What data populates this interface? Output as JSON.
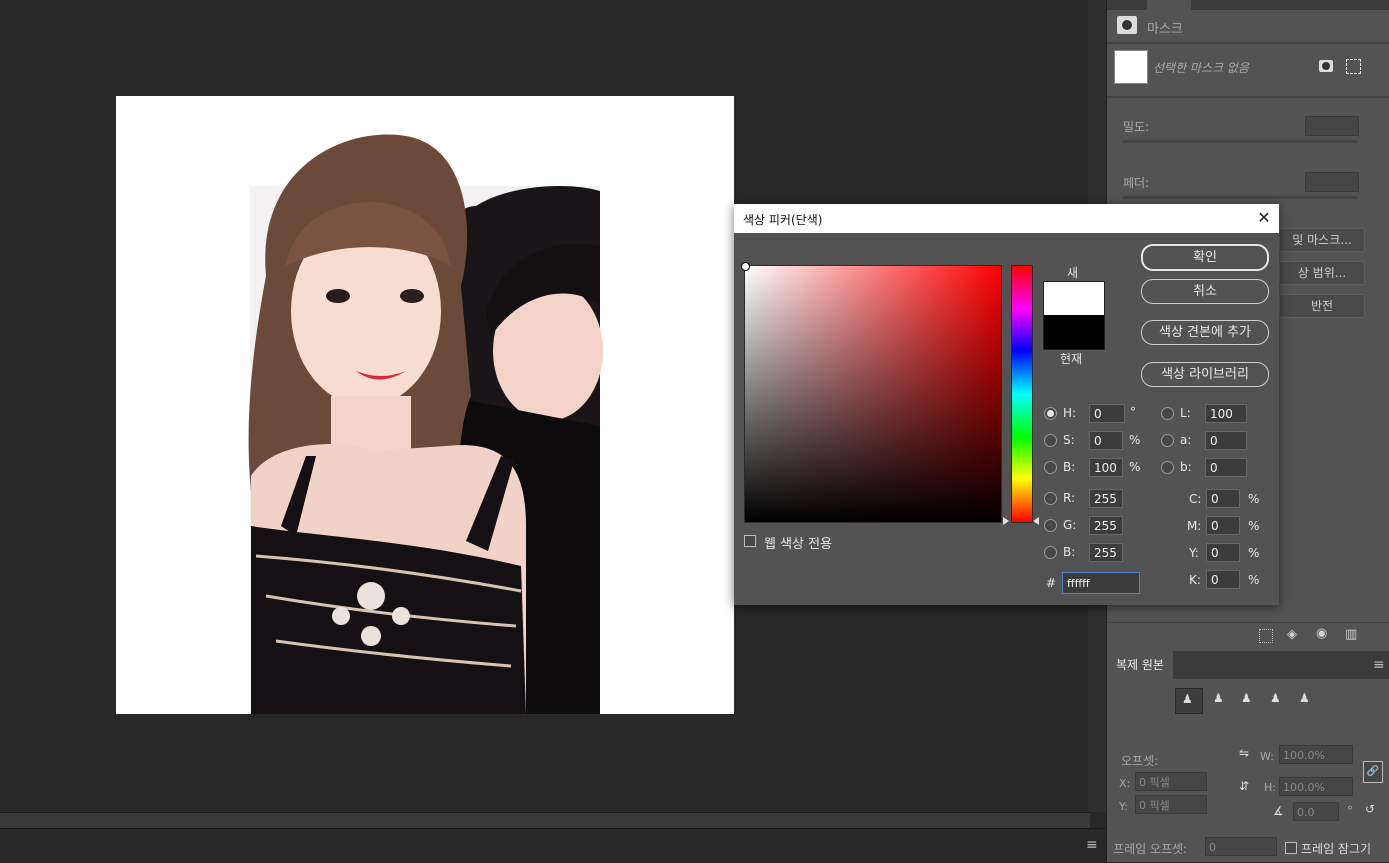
{
  "dialog": {
    "title": "색상 피커(단색)",
    "close_glyph": "✕",
    "new_label": "새",
    "current_label": "현재",
    "buttons": {
      "ok": "확인",
      "cancel": "취소",
      "add_to_swatches": "색상 견본에 추가",
      "color_libraries": "색상 라이브러리"
    },
    "web_only_label": "웹 색상 전용",
    "hsb": {
      "h_label": "H:",
      "h_value": "0",
      "h_unit": "°",
      "s_label": "S:",
      "s_value": "0",
      "s_unit": "%",
      "b_label": "B:",
      "b_value": "100",
      "b_unit": "%"
    },
    "lab": {
      "l_label": "L:",
      "l_value": "100",
      "a_label": "a:",
      "a_value": "0",
      "b_label": "b:",
      "b_value": "0"
    },
    "rgb": {
      "r_label": "R:",
      "r_value": "255",
      "g_label": "G:",
      "g_value": "255",
      "b_label": "B:",
      "b_value": "255"
    },
    "cmyk": {
      "c_label": "C:",
      "c_value": "0",
      "m_label": "M:",
      "m_value": "0",
      "y_label": "Y:",
      "y_value": "0",
      "k_label": "K:",
      "k_value": "0",
      "unit": "%"
    },
    "hex_label": "#",
    "hex_value": "ffffff",
    "selected_hue_color": "#ff0000",
    "new_color": "#ffffff",
    "current_color": "#000000"
  },
  "properties_panel": {
    "mask_title": "마스크",
    "no_mask_text": "선택한 마스크 없음",
    "density_label": "밀도:",
    "feather_label": "페더:",
    "select_mask_button": "및 마스크...",
    "color_range_button": "상 범위...",
    "invert_button": "반전"
  },
  "clone_source_panel": {
    "tab_label": "복제 원본",
    "offset_label": "오프셋:",
    "x_label": "X:",
    "x_placeholder": "0 픽셀",
    "y_label": "Y:",
    "y_placeholder": "0 픽셀",
    "w_label": "W:",
    "w_placeholder": "100.0%",
    "h_label": "H:",
    "h_placeholder": "100.0%",
    "angle_placeholder": "0.0",
    "angle_unit": "°",
    "frame_offset_label": "프레임 오프셋:",
    "frame_offset_placeholder": "0",
    "lock_frame_label": "프레임 잠그기"
  },
  "icons": {
    "panel_menu": "≡",
    "link": "🔗"
  }
}
